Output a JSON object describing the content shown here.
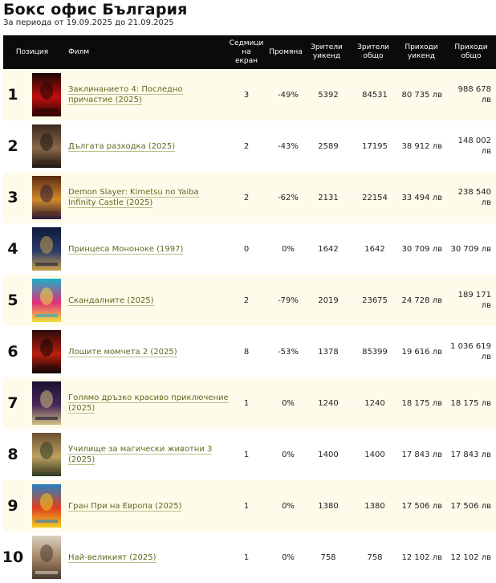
{
  "page": {
    "title": "Бокс офис България",
    "period": "За периода от 19.09.2025 до 21.09.2025"
  },
  "table": {
    "headers": {
      "position": "Позиция",
      "film": "Филм",
      "weeks": "Седмици\nна\nекран",
      "change": "Промяна",
      "viewers_weekend": "Зрители\nуикенд",
      "viewers_total": "Зрители\nобщо",
      "revenue_weekend": "Приходи\nуикенд",
      "revenue_total": "Приходи\nобщо"
    },
    "rows": [
      {
        "rank": "1",
        "title": "Заклинанието 4: Последно причастие (2025)",
        "weeks": "3",
        "change": "-49%",
        "viewers_weekend": "5392",
        "viewers_total": "84531",
        "revenue_weekend": "80 735 лв",
        "revenue_total": "988 678 лв",
        "poster": [
          "#1a0606",
          "#c01010",
          "#2a0404"
        ]
      },
      {
        "rank": "2",
        "title": "Дългата разходка (2025)",
        "weeks": "2",
        "change": "-43%",
        "viewers_weekend": "2589",
        "viewers_total": "17195",
        "revenue_weekend": "38 912 лв",
        "revenue_total": "148 002 лв",
        "poster": [
          "#3a2a1e",
          "#8a6a4a",
          "#1e1610"
        ]
      },
      {
        "rank": "3",
        "title": "Demon Slayer: Kimetsu no Yaiba Infinity Castle (2025)",
        "weeks": "2",
        "change": "-62%",
        "viewers_weekend": "2131",
        "viewers_total": "22154",
        "revenue_weekend": "33 494 лв",
        "revenue_total": "238 540 лв",
        "poster": [
          "#5a2a10",
          "#d08a2a",
          "#2a1a3a"
        ]
      },
      {
        "rank": "4",
        "title": "Принцеса Мононоке (1997)",
        "weeks": "0",
        "change": "0%",
        "viewers_weekend": "1642",
        "viewers_total": "1642",
        "revenue_weekend": "30 709 лв",
        "revenue_total": "30 709 лв",
        "poster": [
          "#101a3a",
          "#2a3a6a",
          "#c9a04a"
        ]
      },
      {
        "rank": "5",
        "title": "Скандалните (2025)",
        "weeks": "2",
        "change": "-79%",
        "viewers_weekend": "2019",
        "viewers_total": "23675",
        "revenue_weekend": "24 728 лв",
        "revenue_total": "189 171 лв",
        "poster": [
          "#1ab0c8",
          "#e0307a",
          "#f0e040"
        ]
      },
      {
        "rank": "6",
        "title": "Лошите момчета 2 (2025)",
        "weeks": "8",
        "change": "-53%",
        "viewers_weekend": "1378",
        "viewers_total": "85399",
        "revenue_weekend": "19 616 лв",
        "revenue_total": "1 036 619 лв",
        "poster": [
          "#2a0a08",
          "#b82010",
          "#100404"
        ]
      },
      {
        "rank": "7",
        "title": "Голямо дръзко красиво приключение (2025)",
        "weeks": "1",
        "change": "0%",
        "viewers_weekend": "1240",
        "viewers_total": "1240",
        "revenue_weekend": "18 175 лв",
        "revenue_total": "18 175 лв",
        "poster": [
          "#1a1030",
          "#4a2a5a",
          "#d0c080"
        ]
      },
      {
        "rank": "8",
        "title": "Училище за магически животни 3 (2025)",
        "weeks": "1",
        "change": "0%",
        "viewers_weekend": "1400",
        "viewers_total": "1400",
        "revenue_weekend": "17 843 лв",
        "revenue_total": "17 843 лв",
        "poster": [
          "#6a5030",
          "#c0a060",
          "#2a3a20"
        ]
      },
      {
        "rank": "9",
        "title": "Гран При на Европа (2025)",
        "weeks": "1",
        "change": "0%",
        "viewers_weekend": "1380",
        "viewers_total": "1380",
        "revenue_weekend": "17 506 лв",
        "revenue_total": "17 506 лв",
        "poster": [
          "#2a80c0",
          "#e04020",
          "#f0d020"
        ]
      },
      {
        "rank": "10",
        "title": "Най-великият (2025)",
        "weeks": "1",
        "change": "0%",
        "viewers_weekend": "758",
        "viewers_total": "758",
        "revenue_weekend": "12 102 лв",
        "revenue_total": "12 102 лв",
        "poster": [
          "#d8d0c0",
          "#a08060",
          "#4a3a30"
        ]
      }
    ]
  }
}
